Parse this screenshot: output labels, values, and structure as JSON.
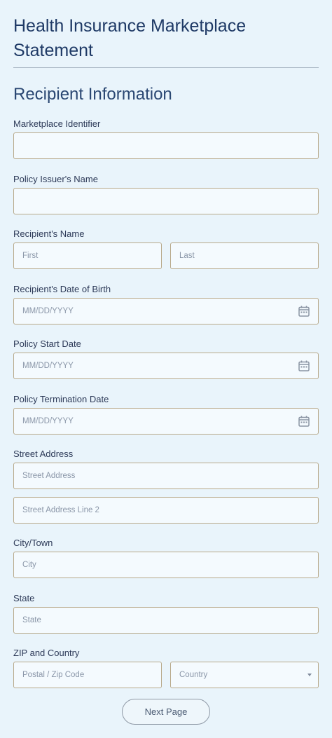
{
  "form": {
    "title": "Health Insurance Marketplace Statement",
    "section_title": "Recipient Information"
  },
  "fields": {
    "marketplace_identifier": {
      "label": "Marketplace Identifier",
      "value": ""
    },
    "policy_issuer_name": {
      "label": "Policy Issuer's Name",
      "value": ""
    },
    "recipient_name": {
      "label": "Recipient's Name",
      "first_placeholder": "First",
      "last_placeholder": "Last"
    },
    "recipient_dob": {
      "label": "Recipient's Date of Birth",
      "placeholder": "MM/DD/YYYY"
    },
    "policy_start_date": {
      "label": "Policy Start Date",
      "placeholder": "MM/DD/YYYY"
    },
    "policy_termination_date": {
      "label": "Policy Termination Date",
      "placeholder": "MM/DD/YYYY"
    },
    "street_address": {
      "label": "Street Address",
      "line1_placeholder": "Street Address",
      "line2_placeholder": "Street Address Line 2"
    },
    "city": {
      "label": "City/Town",
      "placeholder": "City"
    },
    "state": {
      "label": "State",
      "placeholder": "State"
    },
    "zip_country": {
      "label": "ZIP and Country",
      "zip_placeholder": "Postal / Zip Code",
      "country_selected": "Country"
    }
  },
  "actions": {
    "next_label": "Next Page"
  },
  "colors": {
    "background": "#e9f4fb",
    "input_background": "#f4fafe",
    "input_border": "#b8a98a",
    "title": "#1f3a66"
  },
  "icons": {
    "date_picker": "calendar-icon",
    "select": "chevron-down-icon"
  }
}
